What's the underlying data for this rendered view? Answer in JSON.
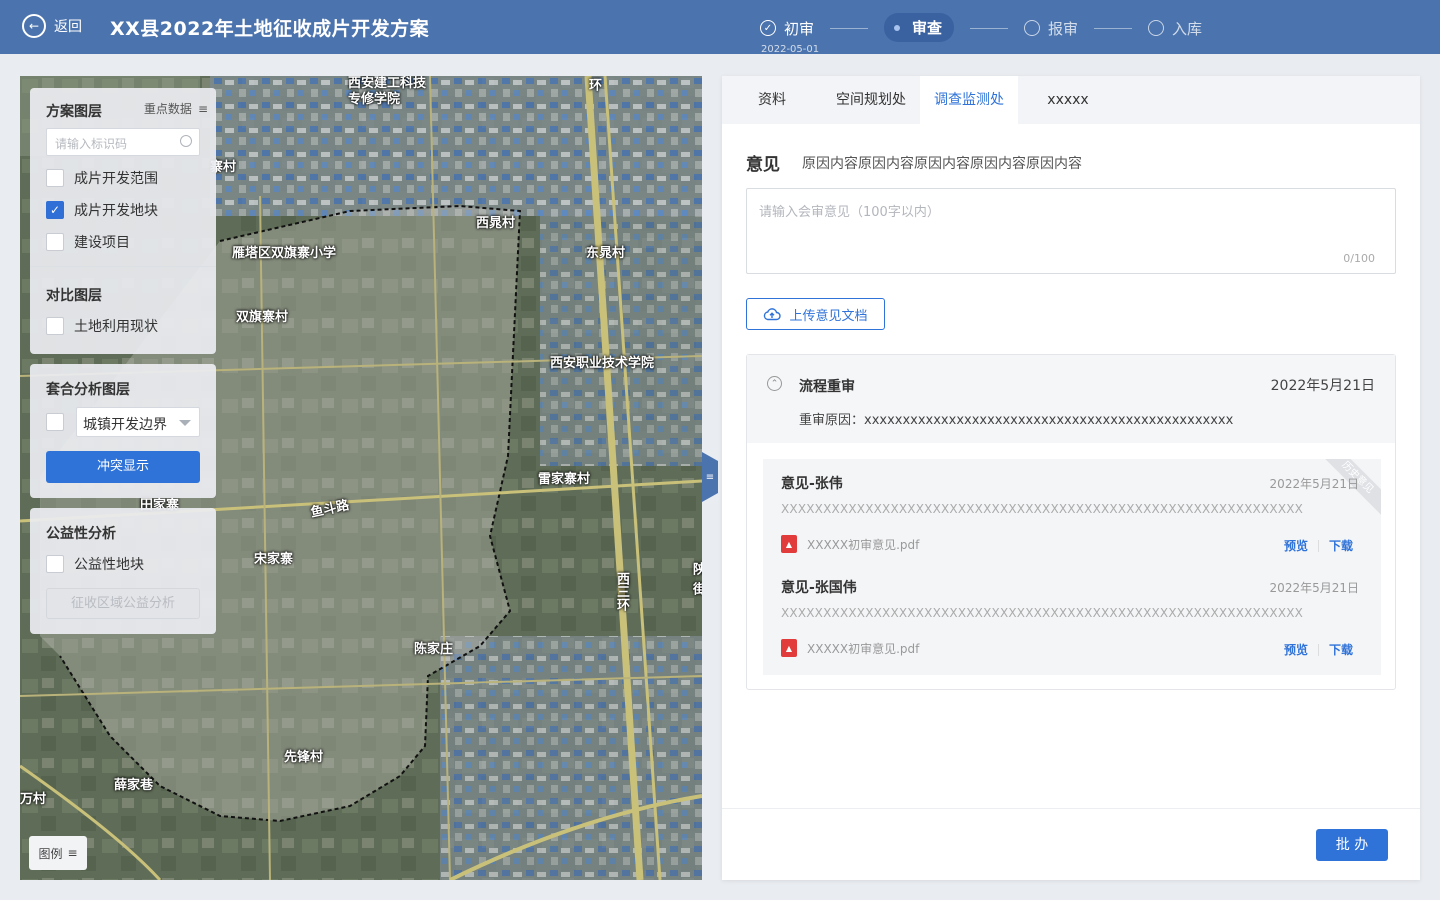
{
  "header": {
    "back_label": "返回",
    "title": "XX县2022年土地征收成片开发方案",
    "steps": [
      {
        "label": "初审",
        "date": "2022-05-01",
        "state": "done"
      },
      {
        "label": "审查",
        "state": "active"
      },
      {
        "label": "报审",
        "state": "pending"
      },
      {
        "label": "入库",
        "state": "pending"
      }
    ]
  },
  "map": {
    "labels": [
      "西安建工科技专修学院",
      "环",
      "寨村",
      "西晁村",
      "东晁村",
      "雁塔区双旗寨小学",
      "双旗寨村",
      "西安职业技术学院",
      "雷家寨村",
      "鱼斗路",
      "田家寨",
      "宋家寨",
      "西三环",
      "陈家庄",
      "先锋村",
      "薛家巷",
      "万村",
      "陕",
      "街"
    ]
  },
  "layers": {
    "scheme_title": "方案图层",
    "key_data_label": "重点数据",
    "search_placeholder": "请输入标识码",
    "scheme_items": [
      {
        "label": "成片开发范围",
        "checked": false
      },
      {
        "label": "成片开发地块",
        "checked": true
      },
      {
        "label": "建设项目",
        "checked": false
      }
    ],
    "compare_title": "对比图层",
    "compare_items": [
      {
        "label": "土地利用现状",
        "checked": false
      }
    ]
  },
  "fit_analysis": {
    "title": "套合分析图层",
    "select_value": "城镇开发边界",
    "conflict_button": "冲突显示"
  },
  "public_interest": {
    "title": "公益性分析",
    "item_label": "公益性地块",
    "analysis_button": "征收区域公益分析"
  },
  "legend_label": "图例",
  "tabs": [
    "资料",
    "空间规划处",
    "调查监测处",
    "xxxxx"
  ],
  "opinion": {
    "label": "意见",
    "reason_text": "原因内容原因内容原因内容原因内容原因内容",
    "textarea_placeholder": "请输入会审意见（100字以内）",
    "counter": "0/100",
    "upload_label": "上传意见文档"
  },
  "history": {
    "title": "流程重审",
    "date": "2022年5月21日",
    "reason": "重审原因：xxxxxxxxxxxxxxxxxxxxxxxxxxxxxxxxxxxxxxxxxxxxxxxx",
    "ribbon": "历史意见",
    "items": [
      {
        "name": "意见-张伟",
        "date": "2022年5月21日",
        "text": "XXXXXXXXXXXXXXXXXXXXXXXXXXXXXXXXXXXXXXXXXXXXXXXXXXXXXXXXXXXXXX",
        "file": "XXXXX初审意见.pdf",
        "preview": "预览",
        "download": "下载"
      },
      {
        "name": "意见-张国伟",
        "date": "2022年5月21日",
        "text": "XXXXXXXXXXXXXXXXXXXXXXXXXXXXXXXXXXXXXXXXXXXXXXXXXXXXXXXXXXXXXX",
        "file": "XXXXX初审意见.pdf",
        "preview": "预览",
        "download": "下载"
      }
    ]
  },
  "footer": {
    "approve_label": "批 办"
  }
}
